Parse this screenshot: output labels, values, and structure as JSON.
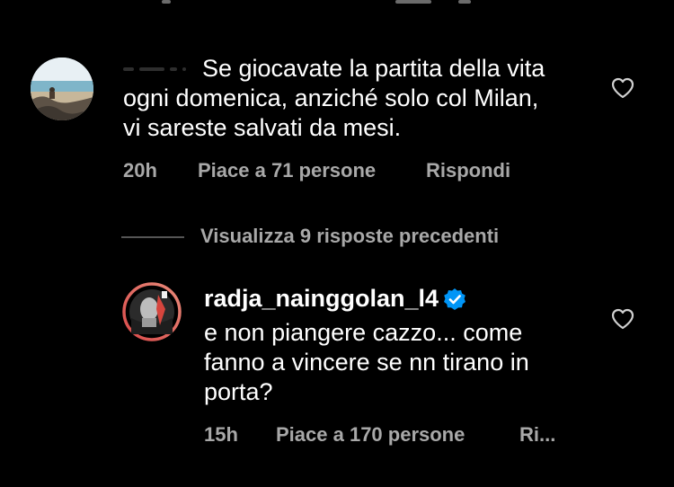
{
  "comment1": {
    "text": "Se giocavate la partita della vita\nogni domenica, anziché solo col Milan,\nvi sareste salvati da mesi.",
    "time": "20h",
    "likes": "Piace a 71 persone",
    "reply": "Rispondi",
    "avatar_icon": "beach-photo-avatar"
  },
  "thread": {
    "view_replies": "Visualizza 9 risposte precedenti"
  },
  "comment2": {
    "username": "radja_nainggolan_l4",
    "text": "e non piangere cazzo... come\nfanno a vincere se nn tirano in\nporta?",
    "time": "15h",
    "likes": "Piace a 170 persone",
    "reply": "Ri...",
    "avatar_icon": "profile-photo-avatar",
    "verified_icon": "verified-badge-icon"
  },
  "colors": {
    "background": "#000000",
    "text": "#ffffff",
    "secondary": "#a8a8a8",
    "verified": "#0095f6",
    "story_ring": "#c13584"
  }
}
